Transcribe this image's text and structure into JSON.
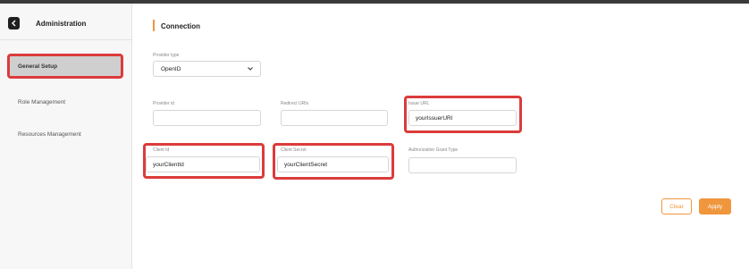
{
  "sidebar": {
    "title": "Administration",
    "items": [
      {
        "label": "General Setup"
      },
      {
        "label": "Role Management"
      },
      {
        "label": "Resources Management"
      }
    ]
  },
  "main": {
    "section_title": "Connection",
    "accent_color": "#f0963c",
    "highlight_color": "#dc3b3b",
    "fields": {
      "provider_type": {
        "label": "Provider type",
        "value": "OpenID"
      },
      "provider_id": {
        "label": "Provider id",
        "value": ""
      },
      "redirect_uris": {
        "label": "Redirect URIs",
        "value": ""
      },
      "issuer_url": {
        "label": "Issue URL",
        "value": "yourIssuerURl"
      },
      "client_id": {
        "label": "Client Id",
        "value": "yourClientId"
      },
      "client_secret": {
        "label": "Client Secret",
        "value": "yourClientSecret"
      },
      "authorization_grant_type": {
        "label": "Authorization Grant Type",
        "value": ""
      }
    },
    "buttons": {
      "clear": "Clear",
      "apply": "Apply"
    }
  }
}
